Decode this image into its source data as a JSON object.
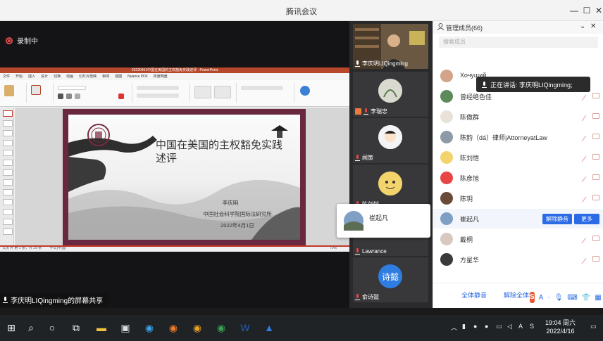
{
  "window": {
    "title": "腾讯会议"
  },
  "stage": {
    "recording_label": "录制中",
    "share_label": "李庆明LIQingming的屏幕共享"
  },
  "ppt": {
    "title": "20220401中国在美国的主权豁免实践述评 - PowerPoint",
    "tabs": [
      "文件",
      "开始",
      "插入",
      "设计",
      "切换",
      "动画",
      "幻灯片放映",
      "审阅",
      "视图",
      "Nuance PDF",
      "百度网盘"
    ],
    "slide": {
      "title": "中国在美国的主权豁免实践述评",
      "author": "李庆明",
      "institution": "中国社会科学院国际法研究所",
      "date": "2022年4月1日"
    },
    "status_left": "幻灯片 第 1 张，共 29 张",
    "status_lang": "中文(中国)",
    "zoom": "70%"
  },
  "videos": [
    {
      "name": "李庆明LIQingming",
      "type": "video"
    },
    {
      "name": "李瑞忠",
      "type": "avatar"
    },
    {
      "name": "闻策",
      "type": "avatar"
    },
    {
      "name": "陈刘恺",
      "type": "avatar"
    },
    {
      "name": "Lawrance",
      "type": "avatar"
    },
    {
      "name": "俞诗懿",
      "type": "avatar",
      "avatar_text": "诗懿"
    }
  ],
  "popup": {
    "name": "崔起凡"
  },
  "panel": {
    "header": "管理成员(66)",
    "search_placeholder": "搜索成员",
    "speaking_tip": "正在讲话: 李庆明LIQingming;",
    "members": [
      {
        "name": "Хочущий..."
      },
      {
        "name": "曾经绝色佳"
      },
      {
        "name": "陈傲群"
      },
      {
        "name": "陈韵（dá）律师|AttorneyatLaw"
      },
      {
        "name": "陈刘恺"
      },
      {
        "name": "陈彦旭"
      },
      {
        "name": "陈玥"
      },
      {
        "name": "崔起凡"
      },
      {
        "name": "戴桐"
      },
      {
        "name": "方星华"
      }
    ],
    "unmute_button": "解除静音",
    "more_button": "更多",
    "mute_all": "全体静音",
    "unmute_all": "解除全体静音",
    "footer_more": "更多"
  },
  "ime": {
    "label": "S",
    "items": [
      "A",
      "·",
      "mic",
      "keyboard",
      "shirt",
      "grid"
    ]
  },
  "taskbar": {
    "time": "19:04 周六",
    "date": "2022/4/16",
    "tray_lang": "A"
  }
}
